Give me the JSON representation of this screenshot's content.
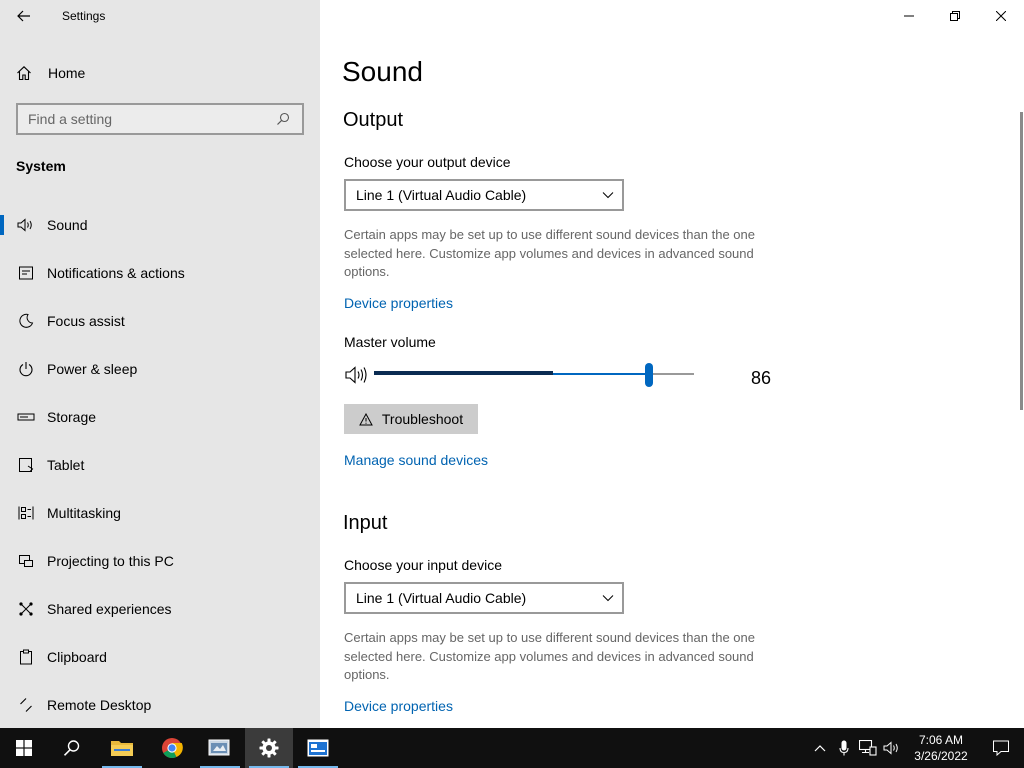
{
  "window": {
    "title": "Settings"
  },
  "sidebar": {
    "home_label": "Home",
    "search_placeholder": "Find a setting",
    "section_label": "System",
    "items": [
      {
        "label": "Sound",
        "icon": "speaker-icon",
        "active": true
      },
      {
        "label": "Notifications & actions",
        "icon": "notifications-icon"
      },
      {
        "label": "Focus assist",
        "icon": "moon-icon"
      },
      {
        "label": "Power & sleep",
        "icon": "power-icon"
      },
      {
        "label": "Storage",
        "icon": "storage-icon"
      },
      {
        "label": "Tablet",
        "icon": "tablet-icon"
      },
      {
        "label": "Multitasking",
        "icon": "multitasking-icon"
      },
      {
        "label": "Projecting to this PC",
        "icon": "projecting-icon"
      },
      {
        "label": "Shared experiences",
        "icon": "shared-experiences-icon"
      },
      {
        "label": "Clipboard",
        "icon": "clipboard-icon"
      },
      {
        "label": "Remote Desktop",
        "icon": "remote-desktop-icon"
      }
    ]
  },
  "main": {
    "page_title": "Sound",
    "output": {
      "heading": "Output",
      "device_label": "Choose your output device",
      "device_value": "Line 1 (Virtual Audio Cable)",
      "description": "Certain apps may be set up to use different sound devices than the one selected here. Customize app volumes and devices in advanced sound options.",
      "device_properties_link": "Device properties",
      "master_volume_label": "Master volume",
      "volume_value": "86",
      "volume_fraction": 0.86,
      "peak_fraction": 0.56,
      "troubleshoot_label": "Troubleshoot",
      "manage_link": "Manage sound devices"
    },
    "input": {
      "heading": "Input",
      "device_label": "Choose your input device",
      "device_value": "Line 1 (Virtual Audio Cable)",
      "description": "Certain apps may be set up to use different sound devices than the one selected here. Customize app volumes and devices in advanced sound options.",
      "device_properties_link": "Device properties"
    }
  },
  "taskbar": {
    "time": "7:06 AM",
    "date": "3/26/2022",
    "accent": "#0067c0"
  }
}
